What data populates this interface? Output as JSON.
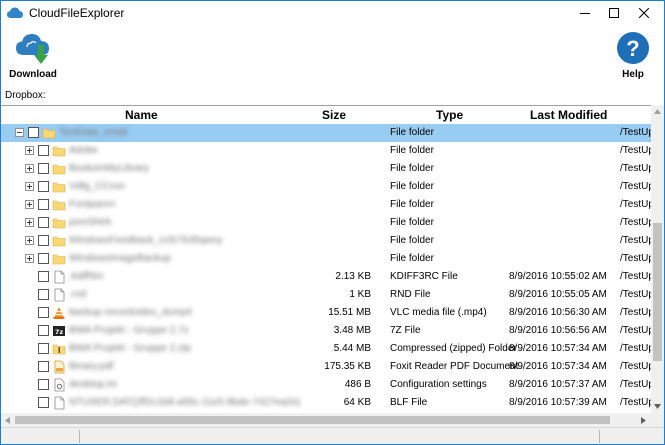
{
  "window": {
    "title": "CloudFileExplorer",
    "controls": [
      "minimize-icon",
      "maximize-icon",
      "close-icon"
    ]
  },
  "toolbar": {
    "download_label": "Download",
    "help_label": "Help"
  },
  "location": {
    "label": "Dropbox:"
  },
  "table": {
    "columns": {
      "name": "Name",
      "size": "Size",
      "type": "Type",
      "modified": "Last Modified"
    },
    "rows": [
      {
        "name": "TestData_small",
        "size": "",
        "type": "File folder",
        "modified": "",
        "path": "/TestUp",
        "icon": "folder-icon",
        "expander": "minus",
        "level": 0,
        "selected": true
      },
      {
        "name": "Adobe",
        "size": "",
        "type": "File folder",
        "modified": "",
        "path": "/TestUp",
        "icon": "folder-icon",
        "expander": "plus",
        "level": 1
      },
      {
        "name": "BooksInMyLibrary",
        "size": "",
        "type": "File folder",
        "modified": "",
        "path": "/TestUp",
        "icon": "folder-icon",
        "expander": "plus",
        "level": 1
      },
      {
        "name": "Vdfg_CCcsn",
        "size": "",
        "type": "File folder",
        "modified": "",
        "path": "/TestUp",
        "icon": "folder-icon",
        "expander": "plus",
        "level": 1
      },
      {
        "name": "Fontpanrrr",
        "size": "",
        "type": "File folder",
        "modified": "",
        "path": "/TestUp",
        "icon": "folder-icon",
        "expander": "plus",
        "level": 1
      },
      {
        "name": "pxmShtrk",
        "size": "",
        "type": "File folder",
        "modified": "",
        "path": "/TestUp",
        "icon": "folder-icon",
        "expander": "plus",
        "level": 1
      },
      {
        "name": "WindowsFeedback_cc5r7k35qwvy",
        "size": "",
        "type": "File folder",
        "modified": "",
        "path": "/TestUp",
        "icon": "folder-icon",
        "expander": "plus",
        "level": 1
      },
      {
        "name": "WindowsImageBackup",
        "size": "",
        "type": "File folder",
        "modified": "",
        "path": "/TestUp",
        "icon": "folder-icon",
        "expander": "plus",
        "level": 1
      },
      {
        "name": ".kdiff3rc",
        "size": "2.13 KB",
        "type": "KDIFF3RC File",
        "modified": "8/9/2016 10:55:02 AM",
        "path": "/TestUp",
        "icon": "file-icon",
        "expander": "",
        "level": 1
      },
      {
        "name": ".rnd",
        "size": "1 KB",
        "type": "RND File",
        "modified": "8/9/2016 10:55:05 AM",
        "path": "/TestUp",
        "icon": "file-icon",
        "expander": "",
        "level": 1
      },
      {
        "name": "backup recordvideo_dcmp4",
        "size": "15.51 MB",
        "type": "VLC media file (.mp4)",
        "modified": "8/9/2016 10:56:30 AM",
        "path": "/TestUp",
        "icon": "vlc-icon",
        "expander": "",
        "level": 1
      },
      {
        "name": "BWA Projekt - Gruppe 2.7z",
        "size": "3.48 MB",
        "type": "7Z File",
        "modified": "8/9/2016 10:56:56 AM",
        "path": "/TestUp",
        "icon": "7z-icon",
        "expander": "",
        "level": 1
      },
      {
        "name": "BWA Projekt - Gruppe 2.zip",
        "size": "5.44 MB",
        "type": "Compressed (zipped) Folder",
        "modified": "8/9/2016 10:57:34 AM",
        "path": "/TestUp",
        "icon": "zip-icon",
        "expander": "",
        "level": 1
      },
      {
        "name": "Binary.pdf",
        "size": "175.35 KB",
        "type": "Foxit Reader PDF Document",
        "modified": "8/9/2016 10:57:34 AM",
        "path": "/TestUp",
        "icon": "pdf-icon",
        "expander": "",
        "level": 1
      },
      {
        "name": "desktop.ini",
        "size": "486 B",
        "type": "Configuration settings",
        "modified": "8/9/2016 10:57:37 AM",
        "path": "/TestUp",
        "icon": "settings-file-icon",
        "expander": "",
        "level": 1
      },
      {
        "name": "NTUSER.DAT{2ff2c1b8-a55c-11e5-9bde-7427ea2e}",
        "size": "64 KB",
        "type": "BLF File",
        "modified": "8/9/2016 10:57:39 AM",
        "path": "/TestUp",
        "icon": "file-icon",
        "expander": "",
        "level": 1
      },
      {
        "name": "",
        "size": "",
        "type": "",
        "modified": "",
        "path": "",
        "icon": "file-icon",
        "expander": "",
        "level": 1,
        "partial": true
      }
    ]
  },
  "colors": {
    "accent": "#1a7fd4",
    "selection": "#99ccf3",
    "folder": "#f8d775"
  }
}
